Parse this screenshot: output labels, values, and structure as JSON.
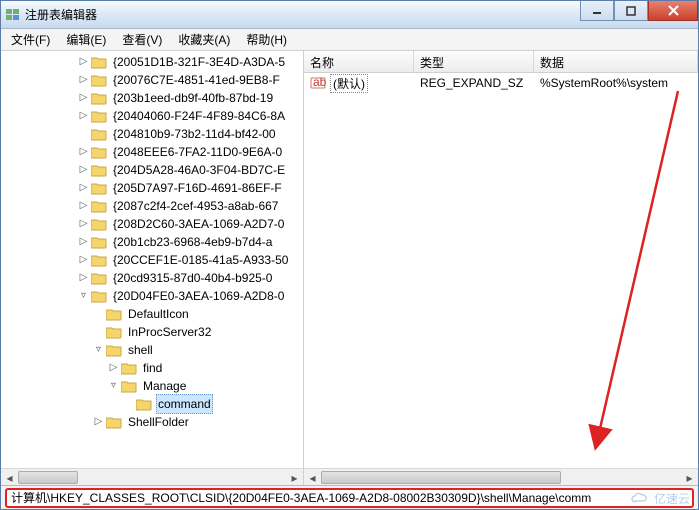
{
  "window": {
    "title": "注册表编辑器"
  },
  "menu": {
    "file": "文件(F)",
    "edit": "编辑(E)",
    "view": "查看(V)",
    "favorites": "收藏夹(A)",
    "help": "帮助(H)"
  },
  "tree": {
    "items": [
      {
        "d": 5,
        "tw": "▷",
        "label": "{20051D1B-321F-3E4D-A3DA-5"
      },
      {
        "d": 5,
        "tw": "▷",
        "label": "{20076C7E-4851-41ed-9EB8-F"
      },
      {
        "d": 5,
        "tw": "▷",
        "label": "{203b1eed-db9f-40fb-87bd-19"
      },
      {
        "d": 5,
        "tw": "▷",
        "label": "{20404060-F24F-4F89-84C6-8A"
      },
      {
        "d": 5,
        "tw": "",
        "label": "{204810b9-73b2-11d4-bf42-00"
      },
      {
        "d": 5,
        "tw": "▷",
        "label": "{2048EEE6-7FA2-11D0-9E6A-0"
      },
      {
        "d": 5,
        "tw": "▷",
        "label": "{204D5A28-46A0-3F04-BD7C-E"
      },
      {
        "d": 5,
        "tw": "▷",
        "label": "{205D7A97-F16D-4691-86EF-F"
      },
      {
        "d": 5,
        "tw": "▷",
        "label": "{2087c2f4-2cef-4953-a8ab-667"
      },
      {
        "d": 5,
        "tw": "▷",
        "label": "{208D2C60-3AEA-1069-A2D7-0"
      },
      {
        "d": 5,
        "tw": "▷",
        "label": "{20b1cb23-6968-4eb9-b7d4-a"
      },
      {
        "d": 5,
        "tw": "▷",
        "label": "{20CCEF1E-0185-41a5-A933-50"
      },
      {
        "d": 5,
        "tw": "▷",
        "label": "{20cd9315-87d0-40b4-b925-0"
      },
      {
        "d": 5,
        "tw": "▿",
        "label": "{20D04FE0-3AEA-1069-A2D8-0"
      },
      {
        "d": 6,
        "tw": "",
        "label": "DefaultIcon"
      },
      {
        "d": 6,
        "tw": "",
        "label": "InProcServer32"
      },
      {
        "d": 6,
        "tw": "▿",
        "label": "shell"
      },
      {
        "d": 7,
        "tw": "▷",
        "label": "find"
      },
      {
        "d": 7,
        "tw": "▿",
        "label": "Manage"
      },
      {
        "d": 8,
        "tw": "",
        "label": "command",
        "selected": true
      },
      {
        "d": 6,
        "tw": "▷",
        "label": "ShellFolder"
      }
    ]
  },
  "list": {
    "headers": {
      "name": "名称",
      "type": "类型",
      "data": "数据"
    },
    "rows": [
      {
        "icon": "ab",
        "name": "(默认)",
        "type": "REG_EXPAND_SZ",
        "data": "%SystemRoot%\\system"
      }
    ]
  },
  "status": {
    "path": "计算机\\HKEY_CLASSES_ROOT\\CLSID\\{20D04FE0-3AEA-1069-A2D8-08002B30309D}\\shell\\Manage\\comm"
  },
  "watermark": {
    "text": "亿速云"
  }
}
